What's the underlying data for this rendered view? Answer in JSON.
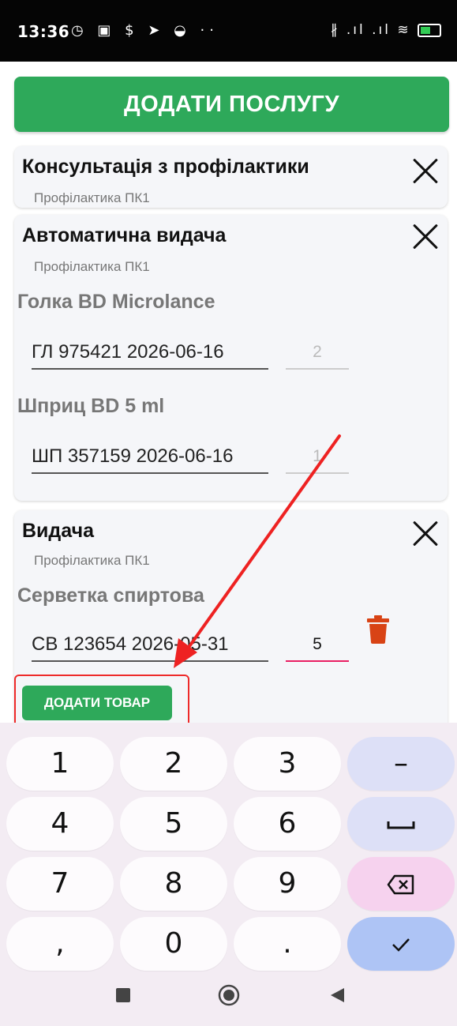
{
  "status_bar": {
    "time": "13:36",
    "left_icons": "◷ ▣ $ ➤ ◒ ··",
    "right_icons": "∦ .ıl .ıl ≋"
  },
  "add_service_label": "ДОДАТИ ПОСЛУГУ",
  "services": [
    {
      "title": "Консультація з профілактики",
      "subtitle": "Профілактика ПК1"
    },
    {
      "title": "Автоматична видача",
      "subtitle": "Профілактика ПК1",
      "items": [
        {
          "name": "Голка BD Microlance",
          "lot": "ГЛ 975421 2026-06-16",
          "qty": "2"
        },
        {
          "name": "Шприц BD 5 ml",
          "lot": "ШП 357159 2026-06-16",
          "qty": "1"
        }
      ]
    },
    {
      "title": "Видача",
      "subtitle": "Профілактика ПК1",
      "items": [
        {
          "name": "Серветка спиртова",
          "lot": "СВ 123654 2026-05-31",
          "qty": "5"
        }
      ],
      "add_product_label": "ДОДАТИ ТОВАР"
    }
  ],
  "keyboard": {
    "rows": [
      [
        "1",
        "2",
        "3",
        "–"
      ],
      [
        "4",
        "5",
        "6",
        "␣"
      ],
      [
        "7",
        "8",
        "9",
        "⌫"
      ],
      [
        ",",
        "0",
        ".",
        "✓"
      ]
    ]
  },
  "colors": {
    "accent_green": "#2ea95a",
    "highlight_red": "#ee2a2a",
    "active_underline": "#e91e63",
    "trash_orange": "#d84315"
  },
  "icons": {
    "close": "close-icon",
    "trash": "trash-icon",
    "backspace": "backspace-icon",
    "check": "check-icon"
  }
}
